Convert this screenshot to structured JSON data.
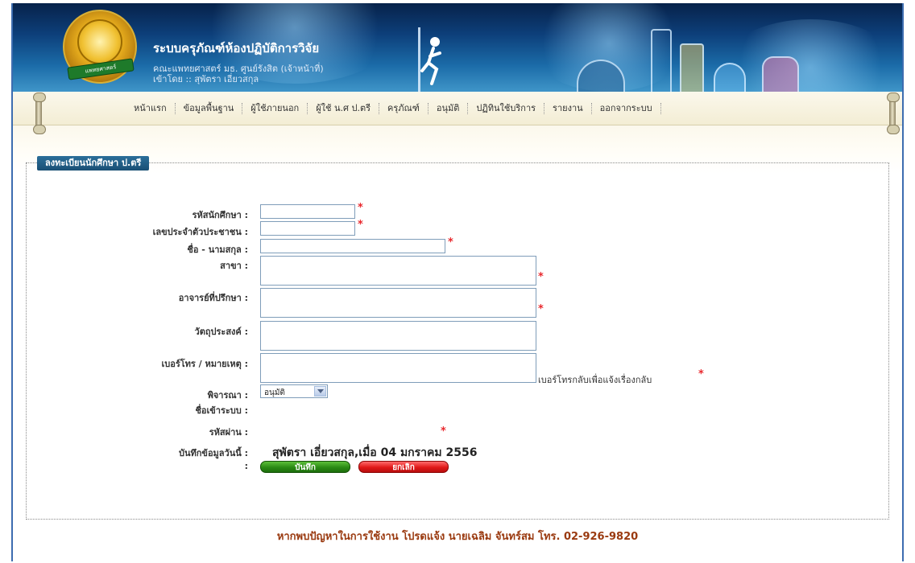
{
  "header": {
    "site_title": "ระบบครุภัณฑ์ห้องปฏิบัติการวิจัย",
    "organization": "คณะแพทยศาสตร์ มธ. ศูนย์รังสิต (เจ้าหน้าที่)",
    "logged_in_as": "เข้าโดย :: สุพัตรา เอี่ยวสกุล",
    "logo_ribbon_text": "แพทยศาสตร์",
    "colors": {
      "banner_top": "#07224a",
      "banner_bottom": "#3f95c8"
    }
  },
  "nav": {
    "items": [
      {
        "label": "หน้าแรก"
      },
      {
        "label": "ข้อมูลพื้นฐาน"
      },
      {
        "label": "ผู้ใช้ภายนอก"
      },
      {
        "label": "ผู้ใช้ น.ศ ป.ตรี"
      },
      {
        "label": "ครุภัณฑ์"
      },
      {
        "label": "อนุมัติ"
      },
      {
        "label": "ปฏิทินใช้บริการ"
      },
      {
        "label": "รายงาน"
      },
      {
        "label": "ออกจากระบบ"
      }
    ]
  },
  "form": {
    "legend": "ลงทะเบียนนักศึกษา ป.ตรี",
    "required_mark": "*",
    "fields": {
      "student_id": {
        "label": "รหัสนักศึกษา :",
        "value": ""
      },
      "citizen_id": {
        "label": "เลขประจำตัวประชาชน :",
        "value": ""
      },
      "fullname": {
        "label": "ชื่อ - นามสกุล :",
        "value": ""
      },
      "major": {
        "label": "สาขา :",
        "value": ""
      },
      "advisor": {
        "label": "อาจารย์ที่ปรึกษา :",
        "value": ""
      },
      "objective": {
        "label": "วัตถุประสงค์ :",
        "value": ""
      },
      "phone_note": {
        "label": "เบอร์โทร / หมายเหตุ  :",
        "value": "",
        "hint": "เบอร์โทรกลับเพื่อแจ้งเรื่องกลับ"
      },
      "consider": {
        "label": "พิจารณา :",
        "selected": "อนุมัติ"
      },
      "username": {
        "label": "ชื่อเข้าระบบ :",
        "value": ""
      },
      "password": {
        "label": "รหัสผ่าน :",
        "value": ""
      },
      "saved_on": {
        "label": "บันทึกข้อมูลวันนี้  :",
        "value": "สุพัตรา เอี่ยวสกุล,เมื่อ 04 มกราคม 2556"
      },
      "actions_label": ":"
    },
    "buttons": {
      "save": "บันทึก",
      "cancel": "ยกเลิก"
    }
  },
  "footer": {
    "contact": "หากพบปัญหาในการใช้งาน โปรดแจ้ง นายเฉลิม จันทร์สม โทร. 02-926-9820"
  }
}
